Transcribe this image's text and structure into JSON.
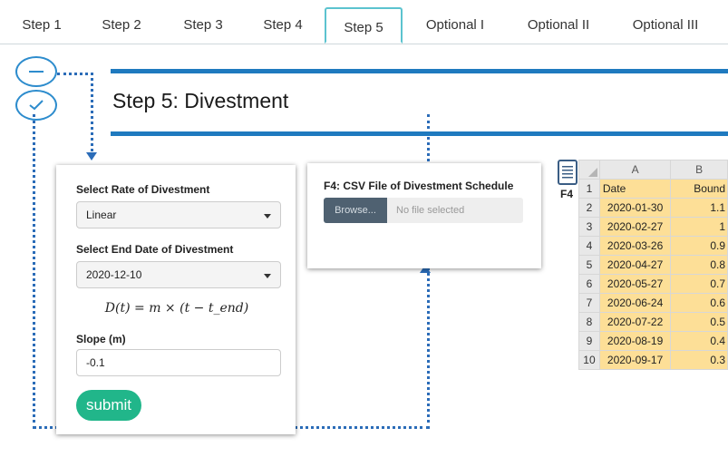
{
  "tabs": [
    {
      "label": "Step 1"
    },
    {
      "label": "Step 2"
    },
    {
      "label": "Step 3"
    },
    {
      "label": "Step 4"
    },
    {
      "label": "Step 5"
    },
    {
      "label": "Optional I"
    },
    {
      "label": "Optional II"
    },
    {
      "label": "Optional III"
    }
  ],
  "active_tab": "Step 5",
  "page_title": "Step 5: Divestment",
  "form": {
    "rate_label": "Select Rate of Divestment",
    "rate_value": "Linear",
    "end_date_label": "Select End Date of Divestment",
    "end_date_value": "2020-12-10",
    "formula": "D(t) = m × (t − t_end)",
    "slope_label": "Slope (m)",
    "slope_value": "-0.1",
    "submit_label": "submit"
  },
  "file_panel": {
    "label": "F4: CSV File of Divestment Schedule",
    "browse_label": "Browse...",
    "placeholder": "No file selected"
  },
  "spreadsheet": {
    "icon": "notepad-icon",
    "icon_label": "F4",
    "columns": [
      "A",
      "B"
    ],
    "header": [
      "Date",
      "Bound"
    ],
    "rows": [
      {
        "num": "1"
      },
      {
        "num": "2",
        "date": "2020-01-30",
        "bound": "1.1"
      },
      {
        "num": "3",
        "date": "2020-02-27",
        "bound": "1"
      },
      {
        "num": "4",
        "date": "2020-03-26",
        "bound": "0.9"
      },
      {
        "num": "5",
        "date": "2020-04-27",
        "bound": "0.8"
      },
      {
        "num": "6",
        "date": "2020-05-27",
        "bound": "0.7"
      },
      {
        "num": "7",
        "date": "2020-06-24",
        "bound": "0.6"
      },
      {
        "num": "8",
        "date": "2020-07-22",
        "bound": "0.5"
      },
      {
        "num": "9",
        "date": "2020-08-19",
        "bound": "0.4"
      },
      {
        "num": "10",
        "date": "2020-09-17",
        "bound": "0.3"
      }
    ]
  },
  "colors": {
    "accent_blue": "#1f7abf",
    "tab_active_border": "#5cc3cf",
    "submit_green": "#21b68a",
    "cell_yellow": "#fddf97",
    "connector_dots": "#2b6cb8"
  }
}
